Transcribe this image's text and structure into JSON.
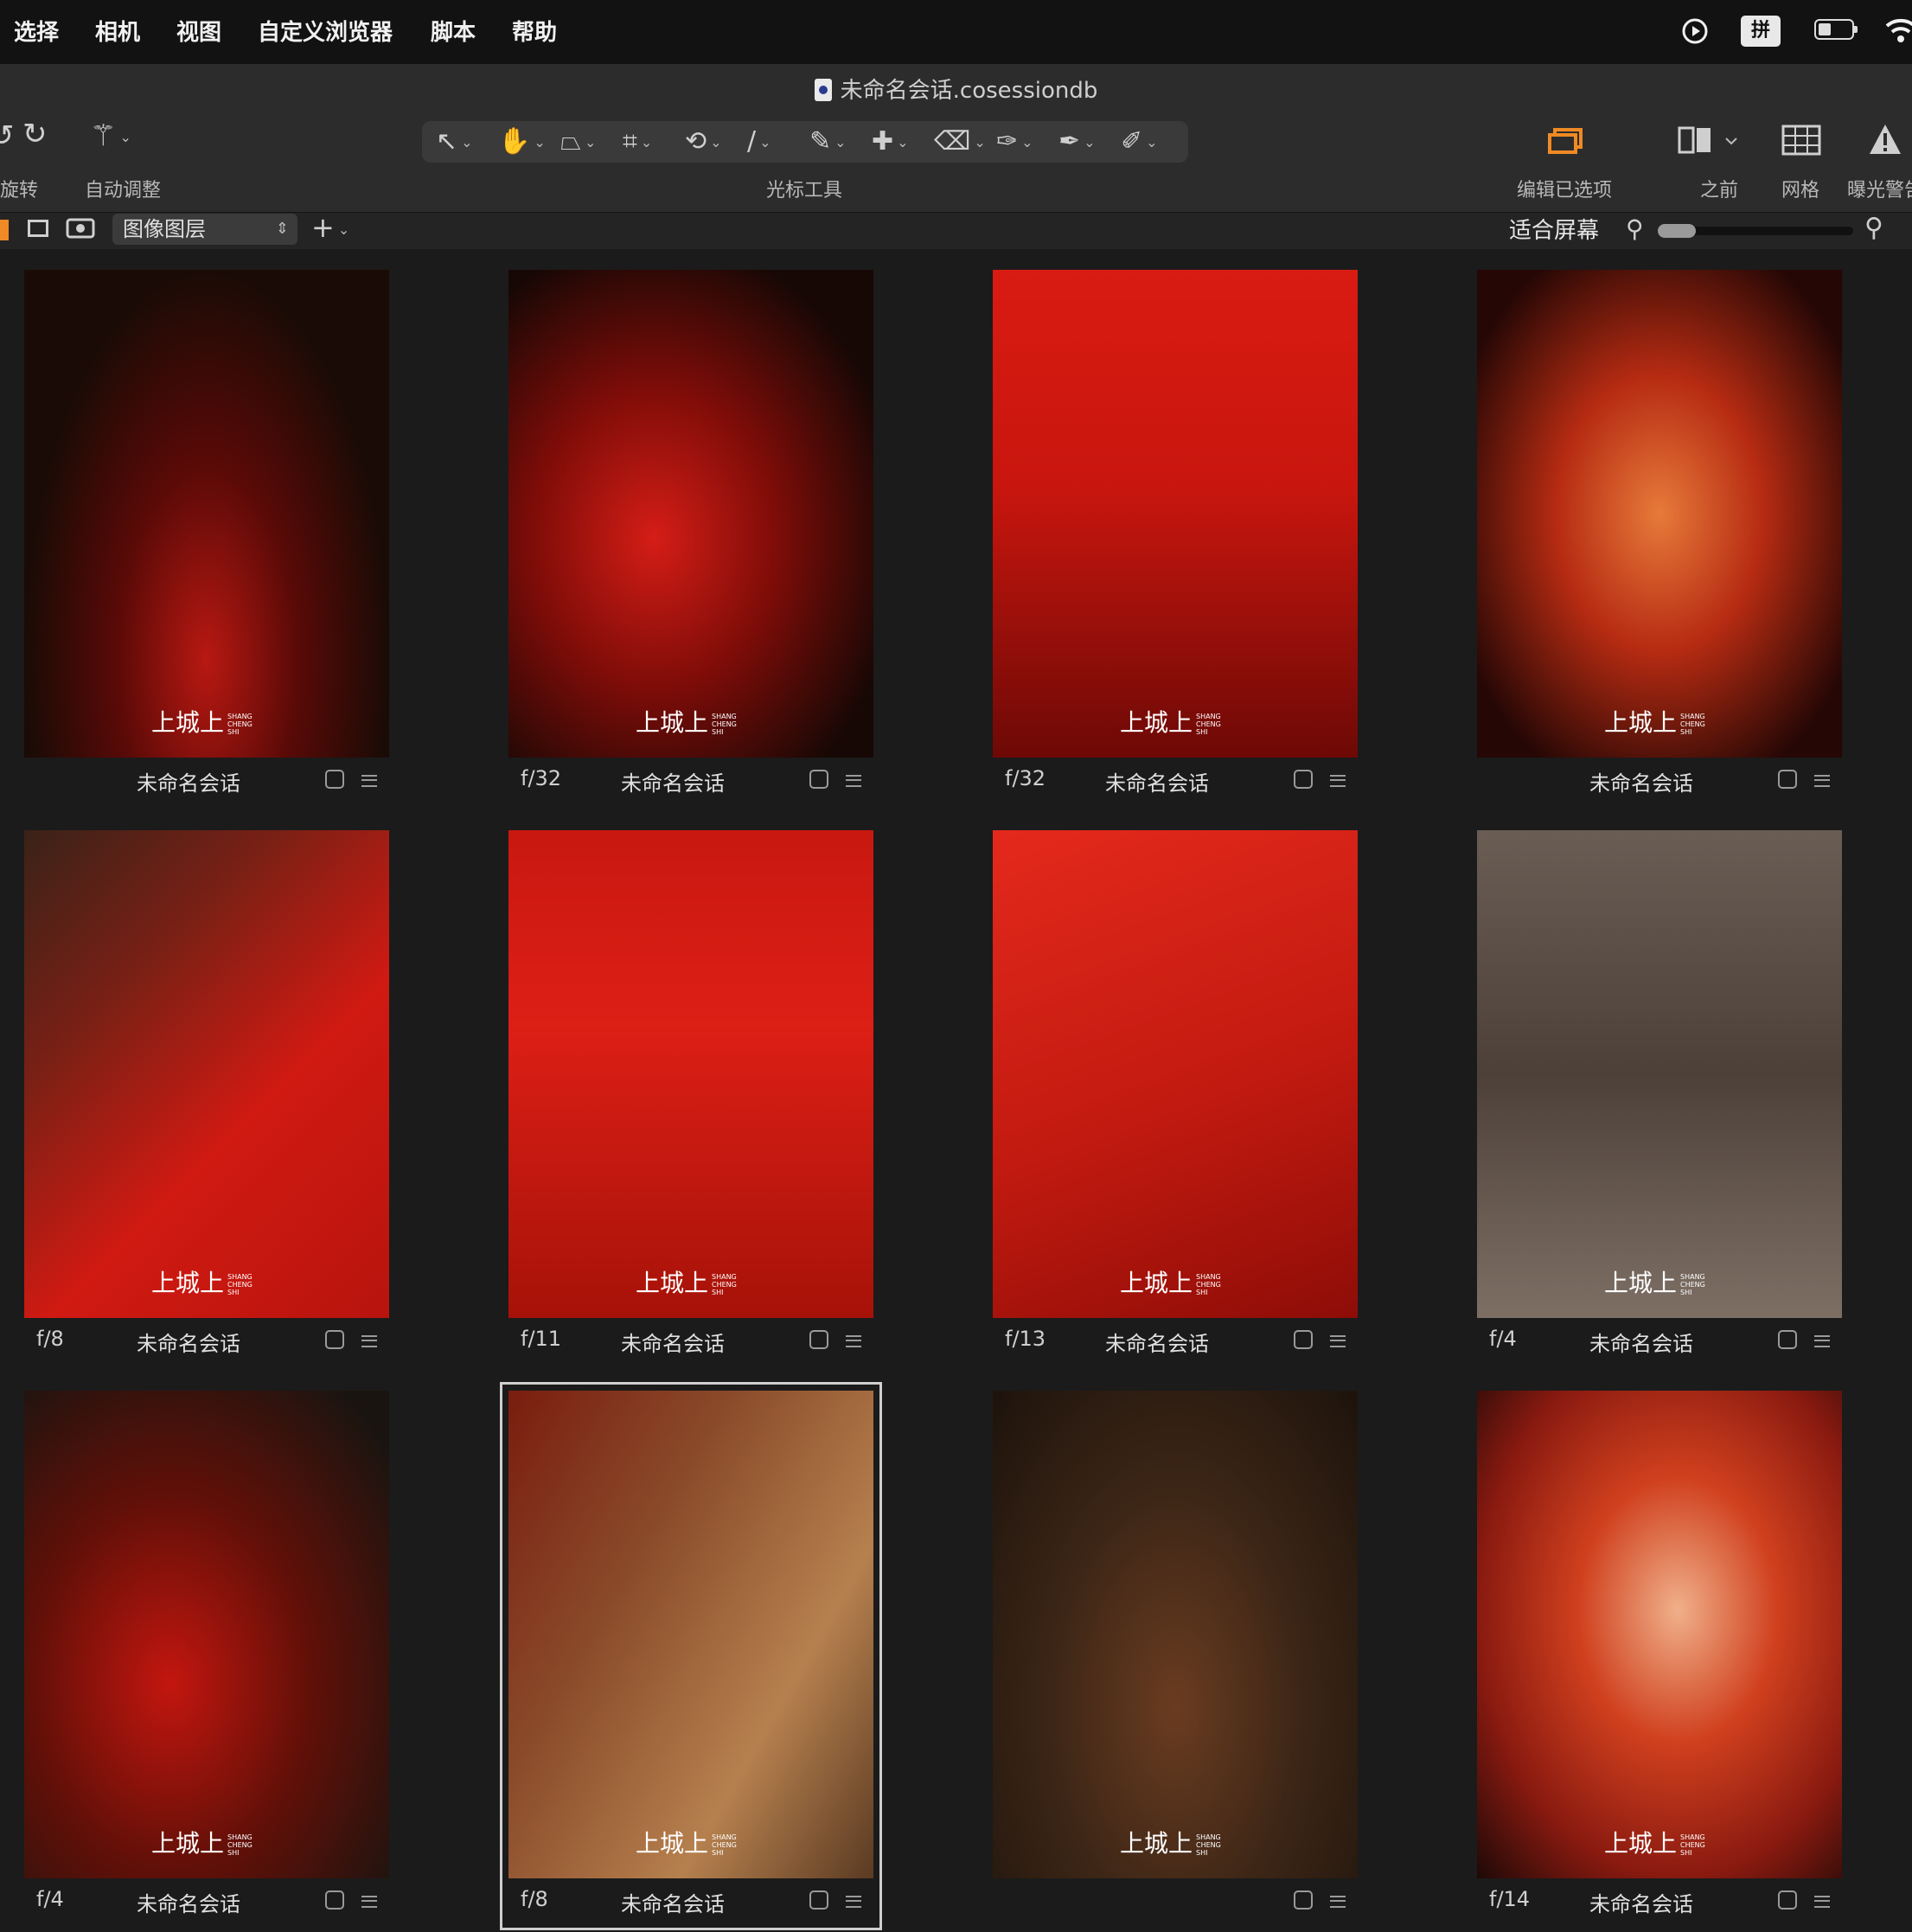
{
  "menu": [
    "选择",
    "相机",
    "视图",
    "自定义浏览器",
    "脚本",
    "帮助"
  ],
  "status": {
    "ime": "拼"
  },
  "document": {
    "title": "未命名会话.cosessiondb"
  },
  "toolbar": {
    "rotate_label": "旋转",
    "auto_adjust_label": "自动调整",
    "cursor_tools_label": "光标工具",
    "edit_selected_label": "编辑已选项",
    "before_label": "之前",
    "grid_label": "网格",
    "exposure_warning_label": "曝光警告"
  },
  "layerbar": {
    "layer_select": "图像图层",
    "fit_label": "适合屏幕",
    "zoom": 0.1
  },
  "thumbnails": [
    {
      "aperture": "",
      "name": "未命名会话",
      "watermark": "上城上"
    },
    {
      "aperture": "f/32",
      "name": "未命名会话",
      "watermark": "上城上"
    },
    {
      "aperture": "f/32",
      "name": "未命名会话",
      "watermark": "上城上"
    },
    {
      "aperture": "",
      "name": "未命名会话",
      "watermark": "上城上"
    },
    {
      "aperture": "f/8",
      "name": "未命名会话",
      "watermark": "上城上"
    },
    {
      "aperture": "f/11",
      "name": "未命名会话",
      "watermark": "上城上"
    },
    {
      "aperture": "f/13",
      "name": "未命名会话",
      "watermark": "上城上"
    },
    {
      "aperture": "f/4",
      "name": "未命名会话",
      "watermark": "上城上"
    },
    {
      "aperture": "f/4",
      "name": "未命名会话",
      "watermark": "上城上"
    },
    {
      "aperture": "f/8",
      "name": "未命名会话",
      "watermark": "上城上",
      "selected": true
    },
    {
      "aperture": "",
      "name": "",
      "watermark": "上城上"
    },
    {
      "aperture": "f/14",
      "name": "未命名会话",
      "watermark": "上城上"
    }
  ],
  "watermark_small": "SHANG CHENG SHI",
  "colors": {
    "accent": "#f08a24",
    "red": "#c4140f"
  }
}
